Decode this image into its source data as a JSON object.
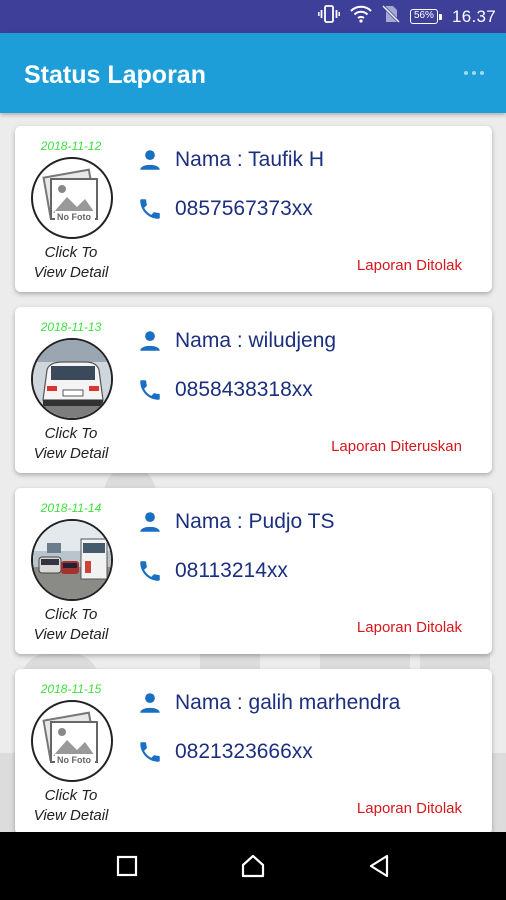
{
  "status_bar": {
    "time": "16.37",
    "battery": "56%",
    "icons": [
      "vibrate-icon",
      "wifi-icon",
      "no-sim-icon",
      "battery-icon"
    ]
  },
  "app_bar": {
    "title": "Status Laporan",
    "menu_icon": "overflow-menu-icon"
  },
  "reports": [
    {
      "date": "2018-11-12",
      "photo": "no-foto",
      "photo_label": "No Foto",
      "click_line1": "Click To",
      "click_line2": "View Detail",
      "name": "Nama : Taufik H",
      "phone": "0857567373xx",
      "status": "Laporan Ditolak"
    },
    {
      "date": "2018-11-13",
      "photo": "car-photo",
      "click_line1": "Click To",
      "click_line2": "View Detail",
      "name": "Nama : wiludjeng",
      "phone": "0858438318xx",
      "status": "Laporan Diteruskan"
    },
    {
      "date": "2018-11-14",
      "photo": "traffic-photo",
      "click_line1": "Click To",
      "click_line2": "View Detail",
      "name": "Nama : Pudjo TS",
      "phone": "08113214xx",
      "status": "Laporan Ditolak"
    },
    {
      "date": "2018-11-15",
      "photo": "no-foto",
      "photo_label": "No Foto",
      "click_line1": "Click To",
      "click_line2": "View Detail",
      "name": "Nama : galih marhendra",
      "phone": "0821323666xx",
      "status": "Laporan Ditolak"
    }
  ],
  "colors": {
    "status_bar": "#3d3f99",
    "app_bar": "#1e9ed9",
    "date": "#3ee03e",
    "text": "#1c2f7e",
    "icon": "#1a6fc2",
    "status_text": "#d8171d",
    "background": "#ececec"
  },
  "nav_bar": {
    "buttons": [
      "recents-square-icon",
      "home-icon",
      "back-icon"
    ]
  }
}
